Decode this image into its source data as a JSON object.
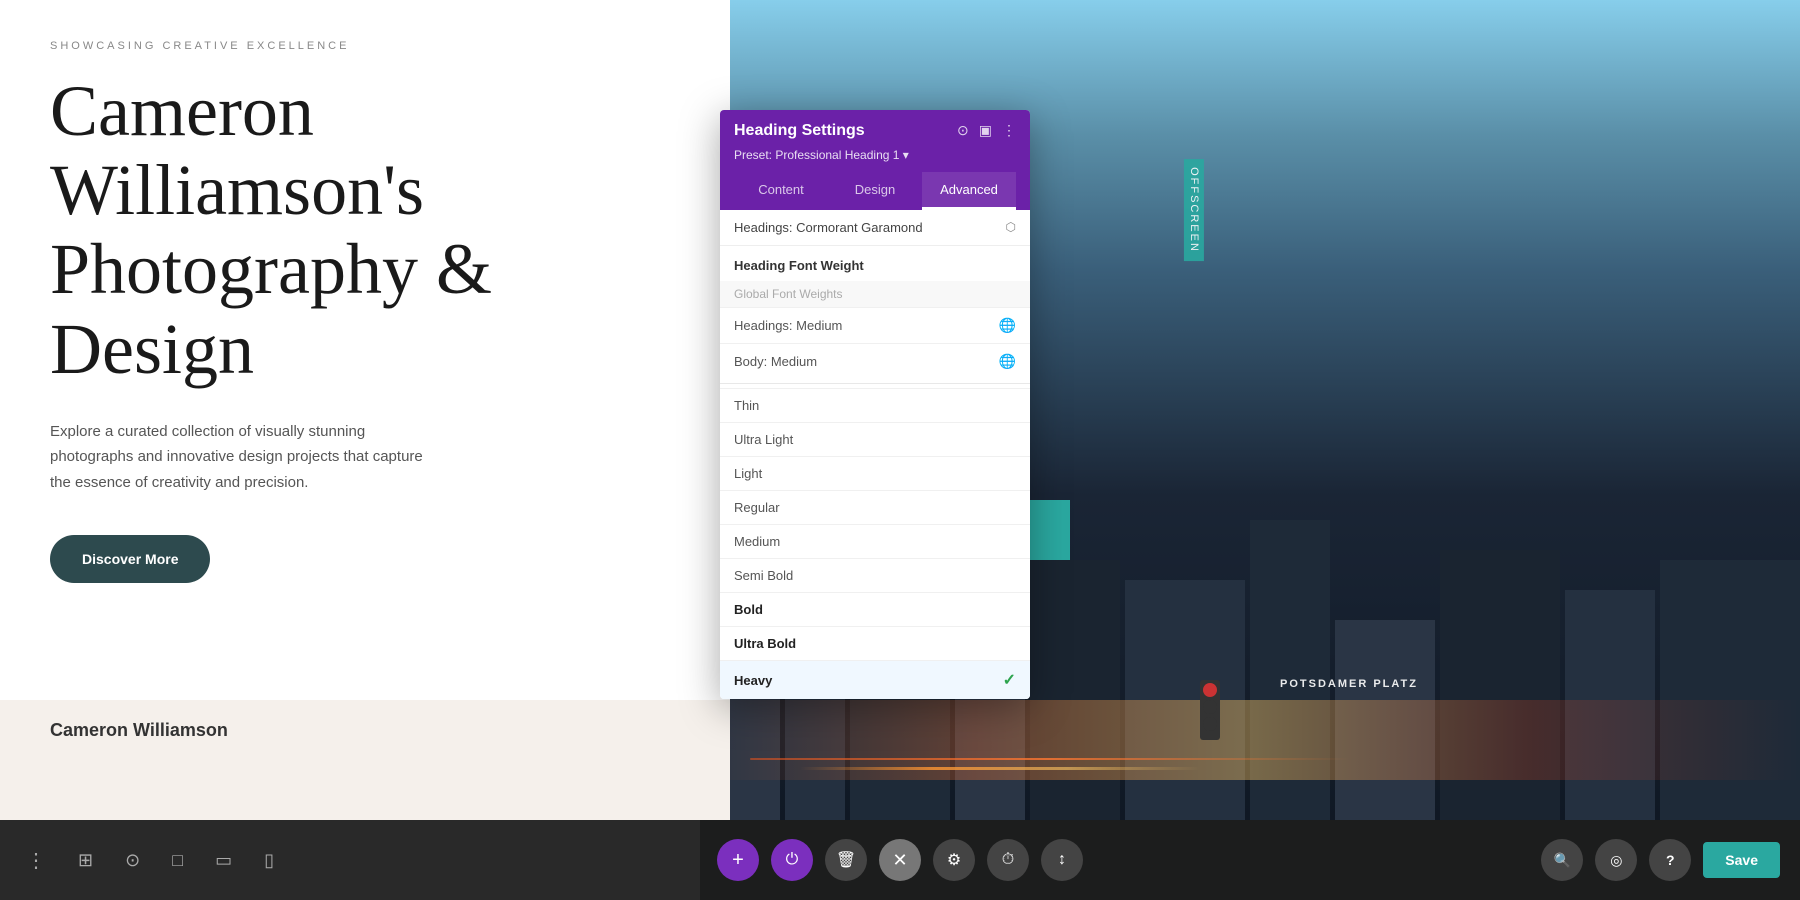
{
  "page": {
    "subtitle": "SHOWCASING CREATIVE EXCELLENCE",
    "main_title": "Cameron Williamson's Photography & Design",
    "description": "Explore a curated collection of visually stunning photographs and innovative design projects that capture the essence of creativity and precision.",
    "discover_btn": "Discover More",
    "offscreen_label": "Offscreen"
  },
  "panel": {
    "title": "Heading Settings",
    "preset": "Preset: Professional Heading 1 ▾",
    "tabs": [
      {
        "label": "Content",
        "active": false
      },
      {
        "label": "Design",
        "active": false
      },
      {
        "label": "Advanced",
        "active": true
      }
    ],
    "font_select": {
      "label": "Headings: Cormorant Garamond",
      "arrow": "⬡"
    },
    "font_weight_section": "Heading Font Weight",
    "global_weights_label": "Global Font Weights",
    "weight_options": [
      {
        "label": "Headings: Medium",
        "globe": true,
        "selected": false,
        "bold": false
      },
      {
        "label": "Body: Medium",
        "globe": true,
        "selected": false,
        "bold": false
      },
      {
        "label": "",
        "divider": true
      },
      {
        "label": "Thin",
        "globe": false,
        "selected": false,
        "bold": false
      },
      {
        "label": "Ultra Light",
        "globe": false,
        "selected": false,
        "bold": false
      },
      {
        "label": "Light",
        "globe": false,
        "selected": false,
        "bold": false
      },
      {
        "label": "Regular",
        "globe": false,
        "selected": false,
        "bold": false
      },
      {
        "label": "Medium",
        "globe": false,
        "selected": false,
        "bold": false
      },
      {
        "label": "Semi Bold",
        "globe": false,
        "selected": false,
        "bold": false
      },
      {
        "label": "Bold",
        "globe": false,
        "selected": false,
        "bold": true
      },
      {
        "label": "Ultra Bold",
        "globe": false,
        "selected": false,
        "bold": true
      },
      {
        "label": "Heavy",
        "globe": false,
        "selected": true,
        "bold": true
      }
    ]
  },
  "toolbar": {
    "left_icons": [
      "⋮",
      "⊞",
      "⊙",
      "□",
      "◻",
      "▭"
    ],
    "center_buttons": [
      {
        "icon": "+",
        "type": "purple",
        "label": "add"
      },
      {
        "icon": "⏻",
        "type": "purple",
        "label": "power"
      },
      {
        "icon": "🗑",
        "type": "dark",
        "label": "delete"
      },
      {
        "icon": "✕",
        "type": "close",
        "label": "close"
      },
      {
        "icon": "⚙",
        "type": "dark",
        "label": "settings"
      },
      {
        "icon": "⏱",
        "type": "dark",
        "label": "timer"
      },
      {
        "icon": "↕",
        "type": "dark",
        "label": "resize"
      }
    ],
    "right_buttons": [
      {
        "icon": "🔍",
        "label": "search"
      },
      {
        "icon": "◎",
        "label": "view"
      },
      {
        "icon": "?",
        "label": "help"
      }
    ],
    "save_label": "Save"
  }
}
